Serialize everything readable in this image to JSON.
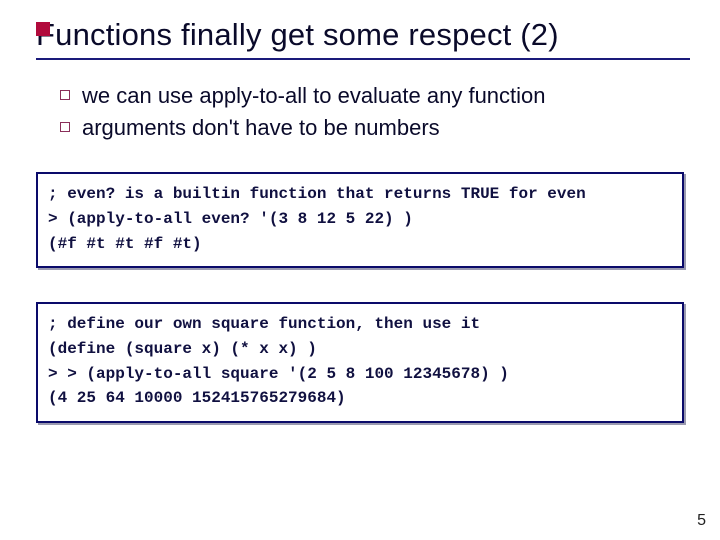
{
  "title": "Functions finally get some respect (2)",
  "bullets": [
    "we can use apply-to-all to evaluate any function",
    "arguments don't have to be numbers"
  ],
  "code_blocks": [
    {
      "lines": [
        "; even? is a builtin function that returns TRUE for even",
        "> (apply-to-all even? '(3 8 12 5 22) )",
        "(#f #t #t #f #t)"
      ]
    },
    {
      "lines": [
        "; define our own square function, then use it",
        "(define (square x) (* x x) )",
        "> > (apply-to-all square '(2 5 8 100 12345678) )",
        "(4 25 64 10000 152415765279684)"
      ]
    }
  ],
  "page_number": "5"
}
